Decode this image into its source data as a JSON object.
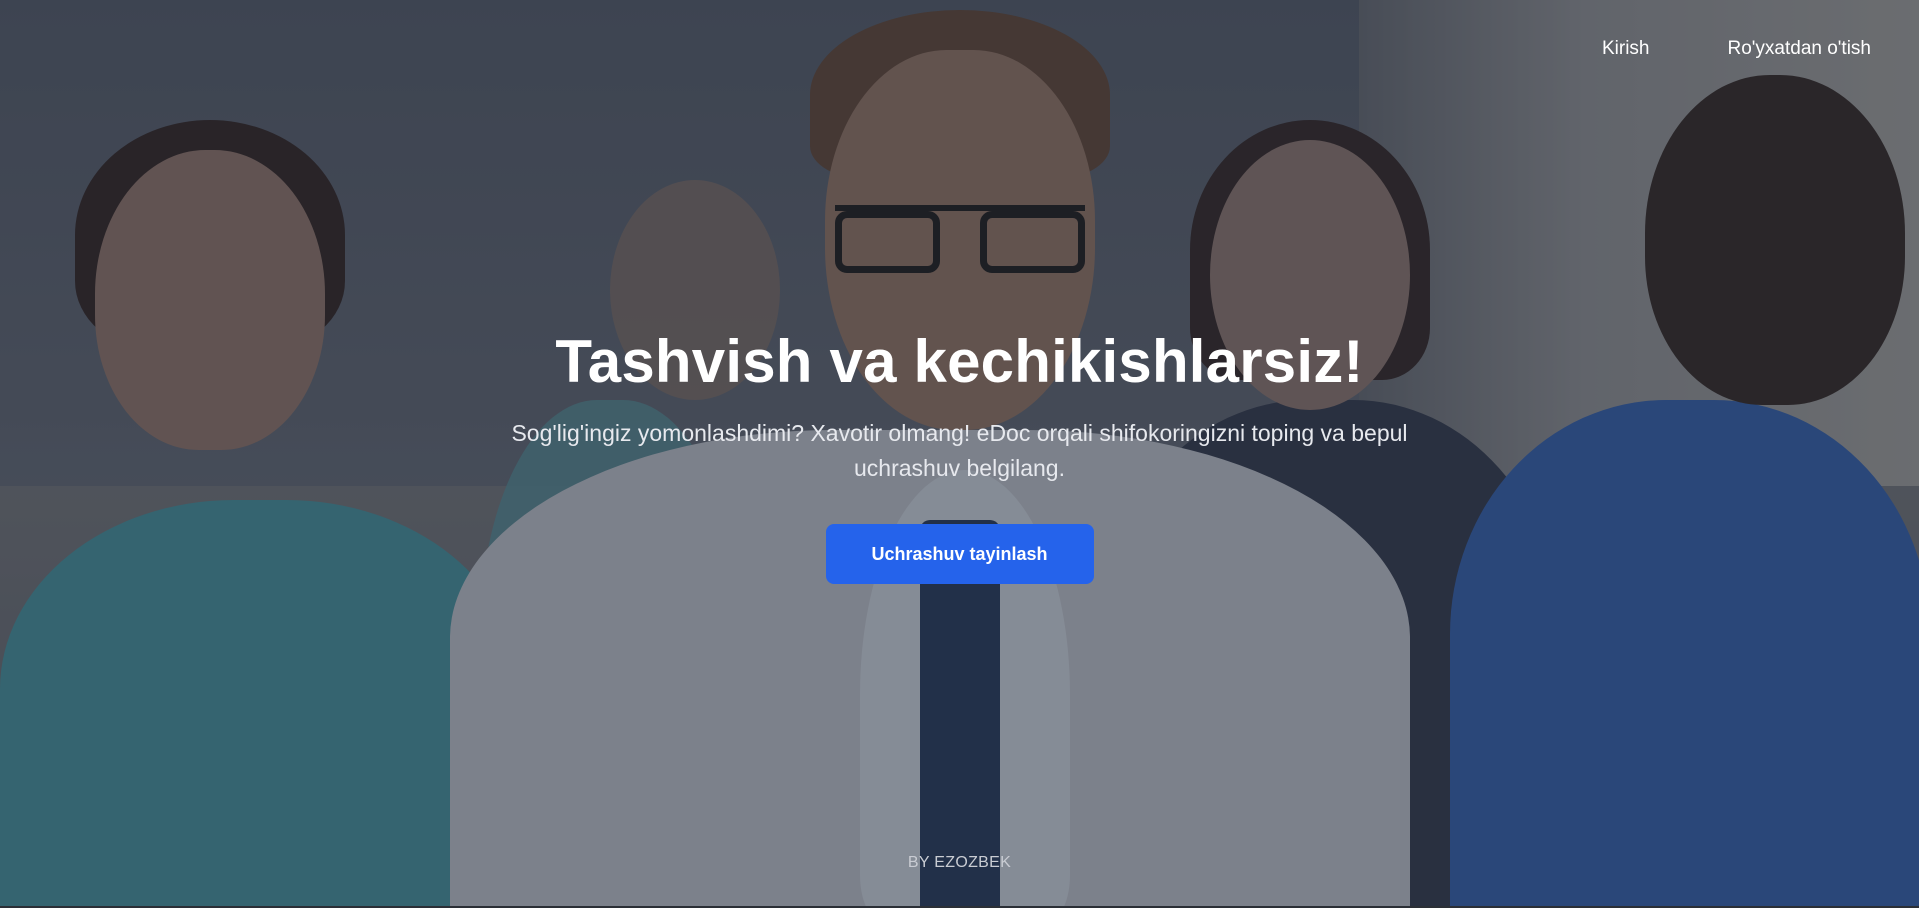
{
  "nav": {
    "login_label": "Kirish",
    "register_label": "Ro'yxatdan o'tish"
  },
  "hero": {
    "title": "Tashvish va kechikishlarsiz!",
    "subtitle": "Sog'lig'ingiz yomonlashdimi? Xavotir olmang! eDoc orqali shifokoringizni toping va bepul uchrashuv belgilang.",
    "cta_label": "Uchrashuv tayinlash"
  },
  "footer": {
    "credit": "BY EZOZBEK"
  },
  "colors": {
    "accent": "#2563eb",
    "text": "#ffffff"
  }
}
